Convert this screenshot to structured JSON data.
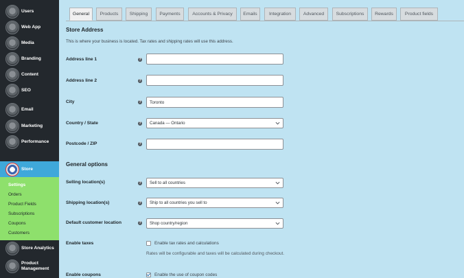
{
  "sidebar": {
    "items": [
      {
        "label": "Users",
        "icon": "users-icon"
      },
      {
        "label": "Web App",
        "icon": "web-app-icon"
      },
      {
        "label": "Media",
        "icon": "media-icon"
      },
      {
        "label": "Branding",
        "icon": "branding-icon"
      },
      {
        "label": "Content",
        "icon": "content-icon"
      },
      {
        "label": "SEO",
        "icon": "seo-icon"
      },
      {
        "label": "Email",
        "icon": "email-icon"
      },
      {
        "label": "Marketing",
        "icon": "marketing-icon"
      },
      {
        "label": "Performance",
        "icon": "performance-icon"
      },
      {
        "label": "Store",
        "icon": "store-icon"
      },
      {
        "label": "Store Analytics",
        "icon": "store-analytics-icon"
      },
      {
        "label": "Product Management",
        "icon": "product-management-icon"
      }
    ],
    "submenu": [
      "Settings",
      "Orders",
      "Product Fields",
      "Subscriptions",
      "Coupons",
      "Customers"
    ]
  },
  "tabs": [
    "General",
    "Products",
    "Shipping",
    "Payments",
    "Accounts & Privacy",
    "Emails",
    "Integration",
    "Advanced",
    "Subscriptions",
    "Rewards",
    "Product fields"
  ],
  "store_address": {
    "heading": "Store Address",
    "description": "This is where your business is located. Tax rates and shipping rates will use this address.",
    "fields": [
      {
        "label": "Address line 1",
        "value": ""
      },
      {
        "label": "Address line 2",
        "value": ""
      },
      {
        "label": "City",
        "value": "Toronto"
      },
      {
        "label": "Country / State",
        "value": "Canada — Ontario"
      },
      {
        "label": "Postcode / ZIP",
        "value": ""
      }
    ]
  },
  "general_options": {
    "heading": "General options",
    "selling_locations": {
      "label": "Selling location(s)",
      "value": "Sell to all countries"
    },
    "shipping_locations": {
      "label": "Shipping location(s)",
      "value": "Ship to all countries you sell to"
    },
    "default_customer_location": {
      "label": "Default customer location",
      "value": "Shop country/region"
    },
    "enable_taxes": {
      "label": "Enable taxes",
      "checkbox_label": "Enable tax rates and calculations",
      "checked": false,
      "note": "Rates will be configurable and taxes will be calculated during checkout."
    },
    "enable_coupons": {
      "label": "Enable coupons",
      "checkbox_label": "Enable the use of coupon codes",
      "checked": true
    }
  },
  "colors": {
    "sidebar": "#23282d",
    "active_item": "#3fa8da",
    "submenu": "#8ee06c",
    "content_bg": "#bfe3f2"
  }
}
